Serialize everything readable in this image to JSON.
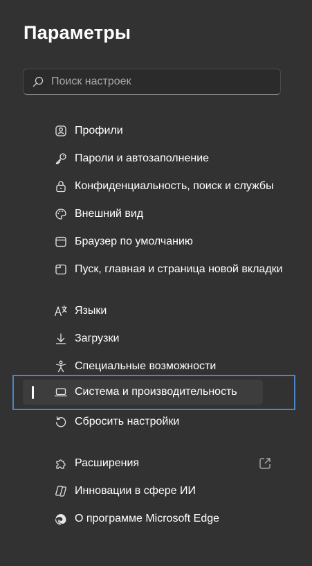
{
  "header": {
    "title": "Параметры"
  },
  "search": {
    "placeholder": "Поиск настроек",
    "icon": "search-icon"
  },
  "accent_color": "#4a86c8",
  "sidebar": {
    "items": [
      {
        "label": "Профили",
        "icon": "profile-icon"
      },
      {
        "label": "Пароли и автозаполнение",
        "icon": "key-icon"
      },
      {
        "label": "Конфиденциальность, поиск и службы",
        "icon": "lock-icon"
      },
      {
        "label": "Внешний вид",
        "icon": "palette-icon"
      },
      {
        "label": "Браузер по умолчанию",
        "icon": "browser-window-icon"
      },
      {
        "label": "Пуск, главная и страница новой вкладки",
        "icon": "new-tab-icon"
      },
      {
        "label": "Языки",
        "icon": "language-icon"
      },
      {
        "label": "Загрузки",
        "icon": "download-icon"
      },
      {
        "label": "Специальные возможности",
        "icon": "accessibility-icon"
      },
      {
        "label": "Система и производительность",
        "icon": "laptop-icon",
        "selected": true
      },
      {
        "label": "Сбросить настройки",
        "icon": "reset-icon"
      },
      {
        "label": "Расширения",
        "icon": "puzzle-icon"
      },
      {
        "label": "Инновации в сфере ИИ",
        "icon": "copilot-icon"
      },
      {
        "label": "О программе Microsoft Edge",
        "icon": "edge-logo-icon"
      }
    ]
  }
}
